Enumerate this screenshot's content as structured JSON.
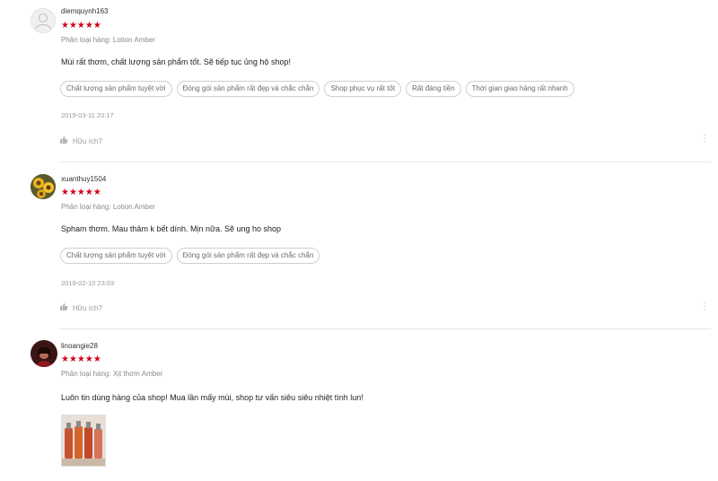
{
  "reviews": [
    {
      "username": "diemquynh163",
      "rating": 5,
      "stars": "★★★★★",
      "variation": "Phân loại hàng: Lotion Amber",
      "comment": "Mùi rất thơm, chất lượng sản phẩm tốt. Sẽ tiếp tục ủng hộ shop!",
      "tags": [
        "Chất lượng sản phẩm tuyệt vời",
        "Đóng gói sản phẩm rất đẹp và chắc chắn",
        "Shop phục vụ rất tốt",
        "Rất đáng tiền",
        "Thời gian giao hàng rất nhanh"
      ],
      "date": "2019-03-11 20:17",
      "helpful_label": "Hữu ích?",
      "avatar": "default-user-icon"
    },
    {
      "username": "xuanthuy1504",
      "rating": 5,
      "stars": "★★★★★",
      "variation": "Phân loại hàng: Lotion Amber",
      "comment": "Spham thơm. Mau thâm k bết dính. Mịn nữa. Sẽ ung ho shop",
      "tags": [
        "Chất lượng sản phẩm tuyệt vời",
        "Đóng gói sản phẩm rất đẹp và chắc chắn"
      ],
      "date": "2019-02-10 23:03",
      "helpful_label": "Hữu ích?",
      "avatar": "sunflower-photo"
    },
    {
      "username": "linoangie28",
      "rating": 5,
      "stars": "★★★★★",
      "variation": "Phân loại hàng: Xịt thơm Amber",
      "comment": "Luôn tin dùng hàng của shop! Mua lần mấy mùi, shop tư vấn siêu siêu nhiệt tình lun!",
      "avatar": "user-photo",
      "media": "product-photo"
    }
  ],
  "colors": {
    "star": "#d0011b",
    "text": "#222222",
    "muted": "#9a9a9a",
    "border": "#cfcfcf"
  }
}
